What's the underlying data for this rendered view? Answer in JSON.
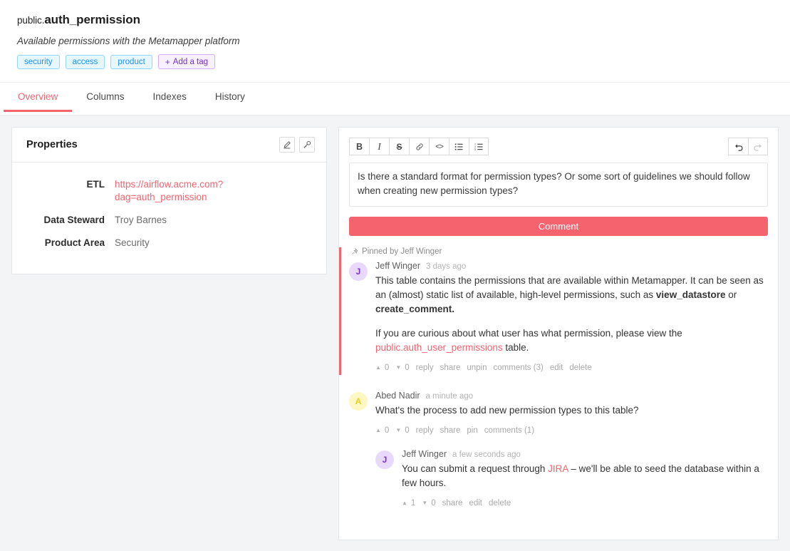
{
  "header": {
    "schema_prefix": "public.",
    "table_name": "auth_permission",
    "description": "Available permissions with the Metamapper platform",
    "tags": [
      "security",
      "access",
      "product"
    ],
    "add_tag_label": "Add a tag",
    "add_tag_icon": "plus-icon"
  },
  "tabs": [
    {
      "label": "Overview",
      "active": true
    },
    {
      "label": "Columns",
      "active": false
    },
    {
      "label": "Indexes",
      "active": false
    },
    {
      "label": "History",
      "active": false
    }
  ],
  "properties_panel": {
    "title": "Properties",
    "edit_icon": "pencil-icon",
    "key_icon": "key-icon",
    "rows": [
      {
        "label": "ETL",
        "value": "https://airflow.acme.com?dag=auth_permission",
        "is_link": true
      },
      {
        "label": "Data Steward",
        "value": "Troy Barnes",
        "is_link": false
      },
      {
        "label": "Product Area",
        "value": "Security",
        "is_link": false
      }
    ]
  },
  "editor": {
    "toolbar": [
      {
        "name": "bold-icon",
        "label": "B"
      },
      {
        "name": "italic-icon",
        "label": "I"
      },
      {
        "name": "strikethrough-icon",
        "label": "S"
      },
      {
        "name": "link-icon",
        "label": "link"
      },
      {
        "name": "code-icon",
        "label": "<>"
      },
      {
        "name": "bullet-list-icon",
        "label": "ul"
      },
      {
        "name": "numbered-list-icon",
        "label": "ol"
      }
    ],
    "undo_icon": "undo-icon",
    "redo_icon": "redo-icon",
    "redo_disabled": true,
    "content": "Is there a standard format for permission types? Or some sort of guidelines we should follow when creating new permission types?",
    "submit_label": "Comment"
  },
  "comments": {
    "pinned": {
      "pin_icon": "pin-icon",
      "pinned_by_label": "Pinned by Jeff Winger",
      "avatar_letter": "J",
      "author": "Jeff Winger",
      "timestamp": "3 days ago",
      "paragraph1_a": "This table contains the permissions that are available within Metamapper. It can be seen as an (almost) static list of available, high-level permissions, such as ",
      "paragraph1_bold1": "view_datastore",
      "paragraph1_b": " or ",
      "paragraph1_bold2": "create_comment.",
      "paragraph2_a": "If you are curious about what user has what permission, please view the ",
      "paragraph2_link": "public.auth_user_permissions",
      "paragraph2_b": " table.",
      "actions": {
        "upvote_icon": "upvote-caret-icon",
        "upvotes": "0",
        "downvote_icon": "downvote-caret-icon",
        "downvotes": "0",
        "reply": "reply",
        "share": "share",
        "pin_toggle": "unpin",
        "comments_count": "comments (3)",
        "edit": "edit",
        "delete": "delete"
      }
    },
    "second": {
      "avatar_letter": "A",
      "author": "Abed Nadir",
      "timestamp": "a minute ago",
      "body": "What's the process to add new permission types to this table?",
      "actions": {
        "upvote_icon": "upvote-caret-icon",
        "upvotes": "0",
        "downvote_icon": "downvote-caret-icon",
        "downvotes": "0",
        "reply": "reply",
        "share": "share",
        "pin_toggle": "pin",
        "comments_count": "comments (1)"
      },
      "reply": {
        "avatar_letter": "J",
        "author": "Jeff Winger",
        "timestamp": "a few seconds ago",
        "body_a": "You can submit a request through ",
        "body_link": "JIRA",
        "body_b": " – we'll be able to seed the database within a few hours.",
        "actions": {
          "upvote_icon": "upvote-caret-icon",
          "upvotes": "1",
          "downvote_icon": "downvote-caret-icon",
          "downvotes": "0",
          "share": "share",
          "edit": "edit",
          "delete": "delete"
        }
      }
    }
  },
  "colors": {
    "accent": "#f5636e",
    "tag_blue": "#1890ff",
    "tag_purple": "#722ed1",
    "avatar_purple_bg": "#e8d9fb",
    "avatar_yellow_bg": "#fdf7c3"
  }
}
